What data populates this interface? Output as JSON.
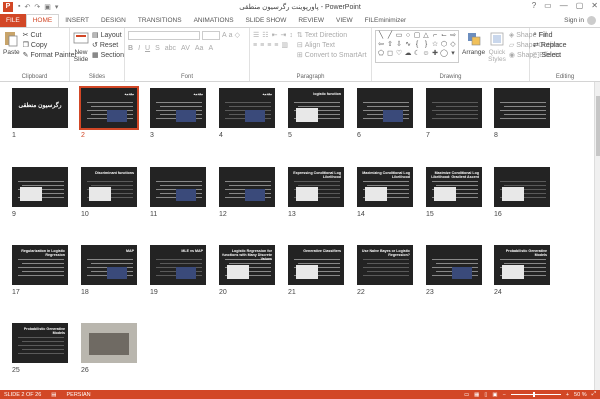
{
  "window": {
    "title": "پاورپوینت رگرسیون منطقی - PowerPoint",
    "app_icon": "P",
    "controls": [
      "?",
      "▭",
      "—",
      "▢",
      "✕"
    ]
  },
  "tabs": [
    "FILE",
    "HOME",
    "INSERT",
    "DESIGN",
    "TRANSITIONS",
    "ANIMATIONS",
    "SLIDE SHOW",
    "REVIEW",
    "VIEW",
    "FILEminimizer"
  ],
  "active_tab": "HOME",
  "signin": "Sign in",
  "ribbon": {
    "clipboard": {
      "label": "Clipboard",
      "paste": "Paste",
      "cut": "Cut",
      "copy": "Copy",
      "format_painter": "Format Painter"
    },
    "slides": {
      "label": "Slides",
      "new_slide": "New",
      "new_slide2": "Slide",
      "layout": "Layout",
      "reset": "Reset",
      "section": "Section"
    },
    "font": {
      "label": "Font"
    },
    "paragraph": {
      "label": "Paragraph",
      "text_direction": "Text Direction",
      "align_text": "Align Text",
      "convert_smartart": "Convert to SmartArt"
    },
    "drawing": {
      "label": "Drawing",
      "arrange": "Arrange",
      "quick_styles": "Quick",
      "quick_styles2": "Styles",
      "shape_fill": "Shape Fill",
      "shape_outline": "Shape Outline",
      "shape_effects": "Shape Effects"
    },
    "editing": {
      "label": "Editing",
      "find": "Find",
      "replace": "Replace",
      "select": "Select"
    }
  },
  "slides": [
    {
      "n": "1",
      "title": "رگرسیون منطقی"
    },
    {
      "n": "2",
      "title": "مقدمه"
    },
    {
      "n": "3",
      "title": "مقدمه"
    },
    {
      "n": "4",
      "title": "مقدمه"
    },
    {
      "n": "5",
      "title": "logistic function"
    },
    {
      "n": "6",
      "title": ""
    },
    {
      "n": "7",
      "title": ""
    },
    {
      "n": "8",
      "title": ""
    },
    {
      "n": "9",
      "title": ""
    },
    {
      "n": "10",
      "title": "Discriminant functions"
    },
    {
      "n": "11",
      "title": ""
    },
    {
      "n": "12",
      "title": ""
    },
    {
      "n": "13",
      "title": "Expressing Conditional Log Likelihood"
    },
    {
      "n": "14",
      "title": "Maximizing Conditional Log Likelihood"
    },
    {
      "n": "15",
      "title": "Maximize Conditional Log Likelihood: Gradient Ascent"
    },
    {
      "n": "16",
      "title": ""
    },
    {
      "n": "17",
      "title": "Regularization in Logistic Regression"
    },
    {
      "n": "18",
      "title": "MAP"
    },
    {
      "n": "19",
      "title": "MLE vs MAP"
    },
    {
      "n": "20",
      "title": "Logistic Regression for functions with Many Discrete Values"
    },
    {
      "n": "21",
      "title": "Generative Classifiers"
    },
    {
      "n": "22",
      "title": "Use Naïve Bayes or Logistic Regression?"
    },
    {
      "n": "23",
      "title": ""
    },
    {
      "n": "24",
      "title": "Probabilistic Generative Models"
    },
    {
      "n": "25",
      "title": "Probabilistic Generative Models"
    },
    {
      "n": "26",
      "title": ""
    }
  ],
  "status": {
    "slide": "SLIDE 2 OF 26",
    "language": "PERSIAN",
    "zoom": "50 %"
  },
  "colors": {
    "accent": "#d24726",
    "slide_bg": "#232323"
  }
}
